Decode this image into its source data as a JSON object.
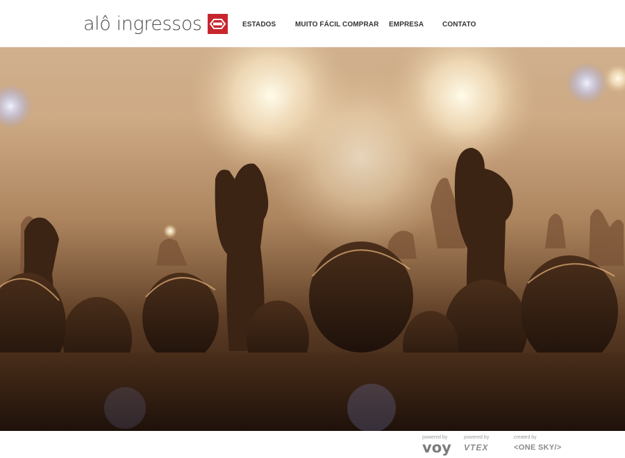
{
  "header": {
    "logo": {
      "text": "alô ingressos",
      "mark_color": "#c8262d"
    },
    "nav": [
      {
        "label": "ESTADOS"
      },
      {
        "label": "MUITO FÁCIL COMPRAR"
      },
      {
        "label": "EMPRESA"
      },
      {
        "label": "CONTATO"
      }
    ]
  },
  "hero": {
    "description_icon": "concert-crowd-photo"
  },
  "footer": {
    "credits": [
      {
        "caption": "powered by",
        "brand": "voy"
      },
      {
        "caption": "powered by",
        "brand": "VTEX"
      },
      {
        "caption": "created by",
        "brand": "<ONE SKY/>"
      }
    ]
  }
}
